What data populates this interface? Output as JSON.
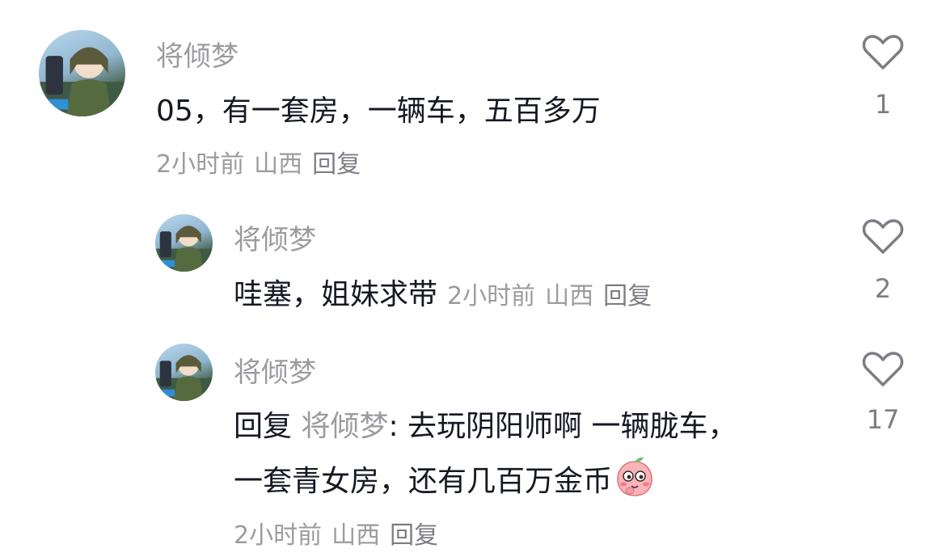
{
  "comments": [
    {
      "username": "将倾梦",
      "text": "05，有一套房，一辆车，五百多万",
      "time": "2小时前",
      "location": "山西",
      "reply_label": "回复",
      "likes": "1"
    }
  ],
  "replies": [
    {
      "username": "将倾梦",
      "text": "哇塞，姐妹求带",
      "time": "2小时前",
      "location": "山西",
      "reply_label": "回复",
      "likes": "2"
    },
    {
      "username": "将倾梦",
      "reply_prefix": "回复",
      "reply_to": "将倾梦",
      "text_line1": ": 去玩阴阳师啊 一辆胧车，",
      "text_line2": "一套青女房，还有几百万金币",
      "emoji": "peach-shy-emoji",
      "time": "2小时前",
      "location": "山西",
      "reply_label": "回复",
      "likes": "17"
    }
  ],
  "colors": {
    "text": "#161823",
    "secondary": "#9b9ba0",
    "icon": "#7d7d85",
    "background": "#ffffff"
  },
  "icons": {
    "like": "heart-outline-icon",
    "avatar": "user-avatar"
  }
}
